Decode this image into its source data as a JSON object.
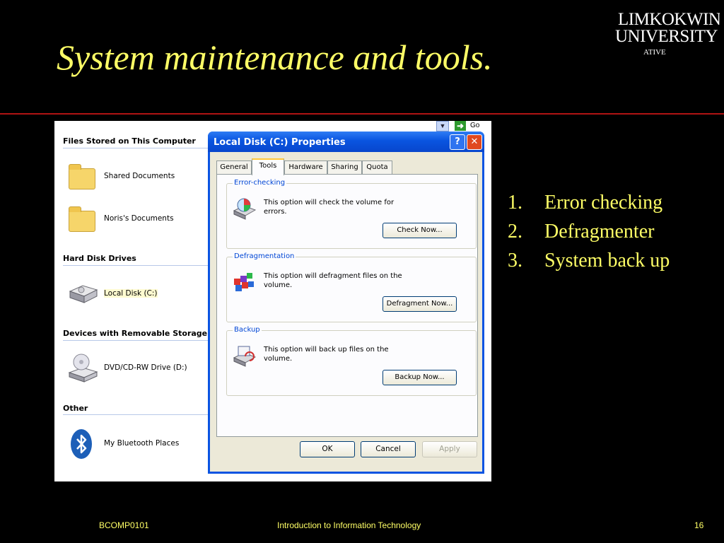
{
  "slide": {
    "title": "System maintenance and tools.",
    "logo": {
      "line1": "LIMKOKWING",
      "line2": "UNIVERSITY",
      "line3": "ATIVE TECHNOLOGY"
    },
    "points": [
      {
        "num": "1.",
        "text": "Error checking"
      },
      {
        "num": "2.",
        "text": "Defragmenter"
      },
      {
        "num": "3.",
        "text": "System back up"
      }
    ],
    "footer": {
      "left": "BCOMP0101",
      "center": "Introduction to Information Technology",
      "page": "16"
    }
  },
  "explorer": {
    "sections": [
      {
        "heading": "Files Stored on This Computer",
        "items": [
          "Shared Documents",
          "Noris's Documents"
        ]
      },
      {
        "heading": "Hard Disk Drives",
        "items": [
          "Local Disk (C:)"
        ]
      },
      {
        "heading": "Devices with Removable Storage",
        "items": [
          "DVD/CD-RW Drive (D:)"
        ]
      },
      {
        "heading": "Other",
        "items": [
          "My Bluetooth Places"
        ]
      }
    ],
    "go_label": "Go"
  },
  "dialog": {
    "title": "Local Disk (C:) Properties",
    "tabs": [
      "General",
      "Tools",
      "Hardware",
      "Sharing",
      "Quota"
    ],
    "active_tab": "Tools",
    "groups": [
      {
        "label": "Error-checking",
        "text": "This option will check the volume for errors.",
        "button": "Check Now..."
      },
      {
        "label": "Defragmentation",
        "text": "This option will defragment files on the volume.",
        "button": "Defragment Now..."
      },
      {
        "label": "Backup",
        "text": "This option will back up files on the volume.",
        "button": "Backup Now..."
      }
    ],
    "buttons": {
      "ok": "OK",
      "cancel": "Cancel",
      "apply": "Apply"
    }
  },
  "colors": {
    "background": "#000000",
    "title_text": "#ffff66",
    "divider": "#b01414",
    "xp_blue": "#0a54e2"
  }
}
